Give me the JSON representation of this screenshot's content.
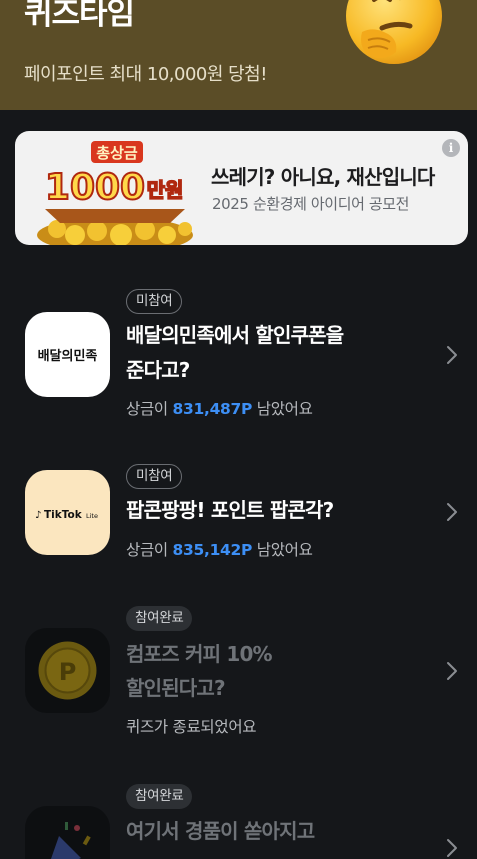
{
  "header": {
    "title": "퀴즈타임",
    "subtitle": "페이포인트 최대 10,000원 당첨!"
  },
  "banner": {
    "art_top": "총상금",
    "art_amount": "1000",
    "art_unit": "만원",
    "title": "쓰레기? 아니요, 재산입니다",
    "subtitle": "2025 순환경제 아이디어 공모전",
    "info_glyph": "i"
  },
  "quizzes": [
    {
      "badge": "미참여",
      "status": "open",
      "logo_text": "배달의민족",
      "title_line1": "배달의민족에서 할인쿠폰을",
      "title_line2": "준다고?",
      "prize_prefix": "상금이",
      "prize_amount": "831,487P",
      "prize_suffix": "남았어요"
    },
    {
      "badge": "미참여",
      "status": "open",
      "logo_text": "TikTok",
      "logo_sub": "Lite",
      "title_line1": "팝콘팡팡! 포인트 팝콘각?",
      "prize_prefix": "상금이",
      "prize_amount": "835,142P",
      "prize_suffix": "남았어요"
    },
    {
      "badge": "참여완료",
      "status": "done",
      "logo_text": "P",
      "title_line1": "컴포즈 커피 10%",
      "title_line2": "할인된다고?",
      "ended_text": "퀴즈가 종료되었어요"
    },
    {
      "badge": "참여완료",
      "status": "done",
      "title_line1": "여기서 경품이 쏟아지고"
    }
  ],
  "colors": {
    "header_bg": "#5b4d27",
    "page_bg": "#15171a",
    "prize_blue": "#3d8ff5"
  }
}
